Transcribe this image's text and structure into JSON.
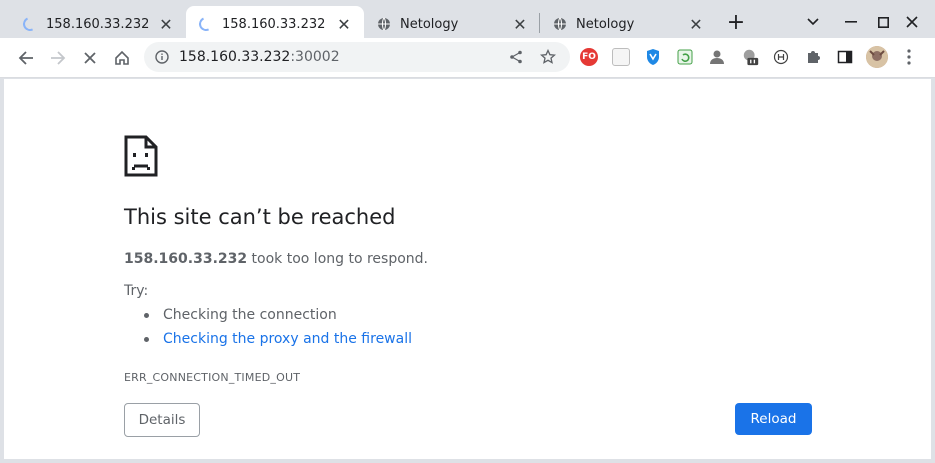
{
  "tabs": [
    {
      "title": "158.160.33.232",
      "favicon": "loading-spinner",
      "active": false
    },
    {
      "title": "158.160.33.232",
      "favicon": "loading-spinner",
      "active": true
    },
    {
      "title": "Netology",
      "favicon": "globe-icon",
      "active": false
    },
    {
      "title": "Netology",
      "favicon": "globe-icon",
      "active": false
    }
  ],
  "toolbar": {
    "url_host": "158.160.33.232",
    "url_port": ":30002"
  },
  "extensions": [
    {
      "name": "fo-extension-icon",
      "label": "FO",
      "color": "#e53935"
    },
    {
      "name": "qr-extension-icon",
      "label": "",
      "color": "#bdbdbd"
    },
    {
      "name": "vpn-shield-icon",
      "label": "",
      "color": "#1e88e5"
    },
    {
      "name": "refresh-extension-icon",
      "label": "",
      "color": "#43a047"
    },
    {
      "name": "user-extension-icon",
      "label": "",
      "color": "#757575"
    },
    {
      "name": "badge-extension-icon",
      "label": "",
      "color": "#424242"
    },
    {
      "name": "circle-h-extension-icon",
      "label": "",
      "color": "#424242"
    }
  ],
  "error": {
    "heading": "This site can’t be reached",
    "host": "158.160.33.232",
    "message": " took too long to respond.",
    "try_label": "Try:",
    "suggestions": [
      {
        "text": "Checking the connection",
        "link": false
      },
      {
        "text": "Checking the proxy and the firewall",
        "link": true
      }
    ],
    "code": "ERR_CONNECTION_TIMED_OUT",
    "details_label": "Details",
    "reload_label": "Reload"
  },
  "colors": {
    "accent": "#1a73e8",
    "text_secondary": "#5f6368"
  }
}
